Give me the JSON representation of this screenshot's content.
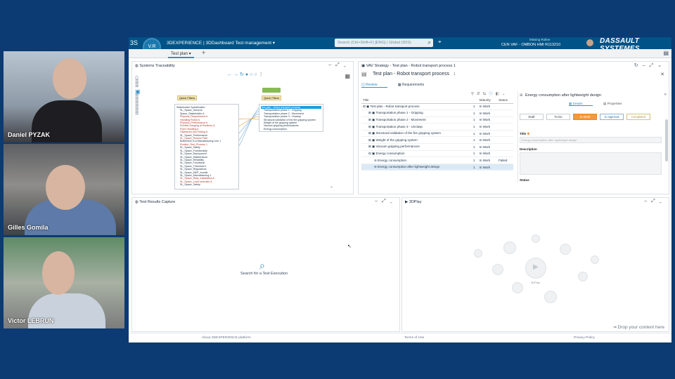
{
  "participants": [
    {
      "name": "Daniel PYZAK"
    },
    {
      "name": "Gilles Gomila"
    },
    {
      "name": "Victor LEBRUN"
    }
  ],
  "topbar": {
    "brand": "3DEXPERIENCE | 3DDashboard",
    "app": "Test management",
    "search_placeholder": "Search (Ctrl+Shift+F) [ENG] | Global (3DS)",
    "user_small": "Missing Rollee",
    "user": "CEN VAF - OMBON HMI R113210",
    "vendor": "DASSAULT SYSTEMES",
    "compass_label": "V.R"
  },
  "tabs": {
    "active": "Test plan"
  },
  "traceability": {
    "title": "Systems Traceability",
    "quick_filters_left": "Quick Filters",
    "quick_filters_right": "Quick Filters",
    "tree_left": [
      "Stakeholder Specification",
      "SL_Space_General",
      "Space_Stakeholder A",
      "Physical_Requirement A",
      "Handling Robot A",
      "Physical_Performance A",
      "Flexible Gauging of Routines A",
      "Point Handling A",
      "Objectives and Testing A",
      "SL_Space_Performance",
      "SL_Space_Routine Path",
      "Bottleneck in a Manufacturing Line 1",
      "Routine_Test_Process 1",
      "SL_Space_Safety",
      "SL_Space_Functionality",
      "SL_Space_Deployment",
      "SL_Space_Maintenance",
      "SL_Space_Reliability",
      "SL_Space_Functional",
      "SL_Space_Threshold 1",
      "SL_Space_Regulations",
      "SL_Space_MMT_bundle",
      "SL_Space_Manufacturing 1",
      "SL_Space_Rally_Installation A",
      "SL_Space_Load controller A",
      "SL_Space_Safety"
    ],
    "tree_right": [
      "Test plan - Robot transport process",
      "Transportation phase 1 - Gripping",
      "Transportation phase 2 - Movement",
      "Transportation phase 3 - Unclasp",
      "Structural validation of the fire gripping system",
      "Weight of the gripping system",
      "Vacuum gripping performances",
      "Energy consumption"
    ]
  },
  "testplan": {
    "window_title": "VAV Strategy - Test plan - Robot transport process 1",
    "title": "Test plan - Robot transport process",
    "title_count": "1",
    "subtab_1": "Review",
    "subtab_2": "Requirements",
    "col_title": "Title",
    "col_maturity": "Maturity",
    "col_status": "Status",
    "rows": [
      {
        "title": "Test plan - Robot transport process",
        "count": "1",
        "maturity": "In Work",
        "status": ""
      },
      {
        "title": "Transportation phase 1 - Gripping",
        "count": "1",
        "maturity": "In Work",
        "status": ""
      },
      {
        "title": "Transportation phase 2 - Movement",
        "count": "1",
        "maturity": "In Work",
        "status": ""
      },
      {
        "title": "Transportation phase 3 - Unclasp",
        "count": "1",
        "maturity": "In Work",
        "status": ""
      },
      {
        "title": "Structural validation of the fire gripping system",
        "count": "1",
        "maturity": "In Work",
        "status": ""
      },
      {
        "title": "Weight of the gripping system",
        "count": "1",
        "maturity": "In Work",
        "status": ""
      },
      {
        "title": "Vacuum gripping performances",
        "count": "1",
        "maturity": "In Work",
        "status": ""
      },
      {
        "title": "Energy consumption",
        "count": "1",
        "maturity": "In Work",
        "status": ""
      },
      {
        "title": "Energy consumption",
        "count": "1",
        "maturity": "In Work",
        "status": "Failed"
      },
      {
        "title": "Energy consumption after lightweight design",
        "count": "1",
        "maturity": "In Work",
        "status": ""
      }
    ],
    "detail": {
      "title": "Energy consumption after lightweight design",
      "tab_details": "Details",
      "tab_properties": "Properties",
      "states": [
        "Draft",
        "To Do",
        "In Work",
        "In Approval",
        "Completed"
      ],
      "title_label": "Title",
      "title_value": "Energy consumption after lightweight design",
      "description_label": "Description",
      "status_label": "Status"
    }
  },
  "results": {
    "title": "Test Results Capture",
    "message": "Search for a Test Execution"
  },
  "play": {
    "title": "3DPlay",
    "hub_label": "3DPlay",
    "drop_text": "Drop your content here"
  },
  "footer": {
    "about": "About 3DEXPERIENCE platform",
    "terms": "Terms of Use",
    "privacy": "Privacy Policy"
  }
}
